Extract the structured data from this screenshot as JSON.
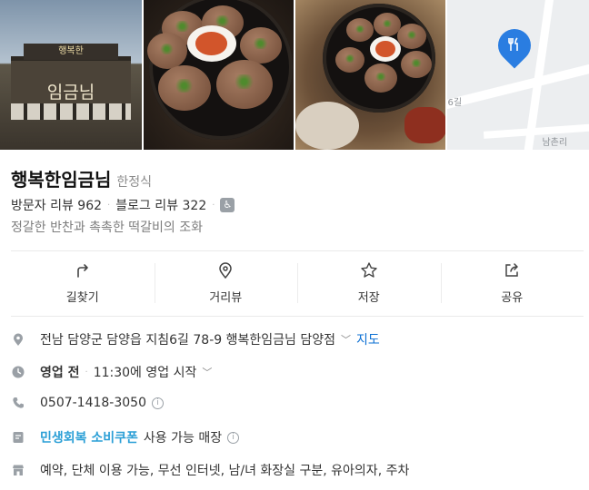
{
  "place": {
    "name": "행복한임금님",
    "category": "한정식",
    "visitor_reviews": "방문자 리뷰 962",
    "blog_reviews": "블로그 리뷰 322",
    "description": "정갈한 반찬과 촉촉한 떡갈비의 조화"
  },
  "gallery": {
    "storefront_sign": "임금님",
    "storefront_top_text": "행복한",
    "map_labels": [
      "6길",
      "남촌리"
    ]
  },
  "actions": [
    {
      "label": "길찾기",
      "icon": "directions-icon"
    },
    {
      "label": "거리뷰",
      "icon": "street-view-pin-icon"
    },
    {
      "label": "저장",
      "icon": "star-icon"
    },
    {
      "label": "공유",
      "icon": "share-icon"
    }
  ],
  "info": {
    "address": "전남 담양군 담양읍 지침6길 78-9 행복한임금님 담양점",
    "map_link": "지도",
    "status": "영업 전",
    "hours": "11:30에 영업 시작",
    "phone": "0507-1418-3050",
    "coupon": "민생회복 소비쿠폰",
    "coupon_suffix": "사용 가능 매장",
    "amenities": "예약, 단체 이용 가능, 무선 인터넷, 남/녀 화장실 구분, 유아의자, 주차"
  },
  "colors": {
    "accent_link": "#0b6fd3",
    "coupon": "#2b9fd6",
    "map_pin": "#2a7de1"
  }
}
